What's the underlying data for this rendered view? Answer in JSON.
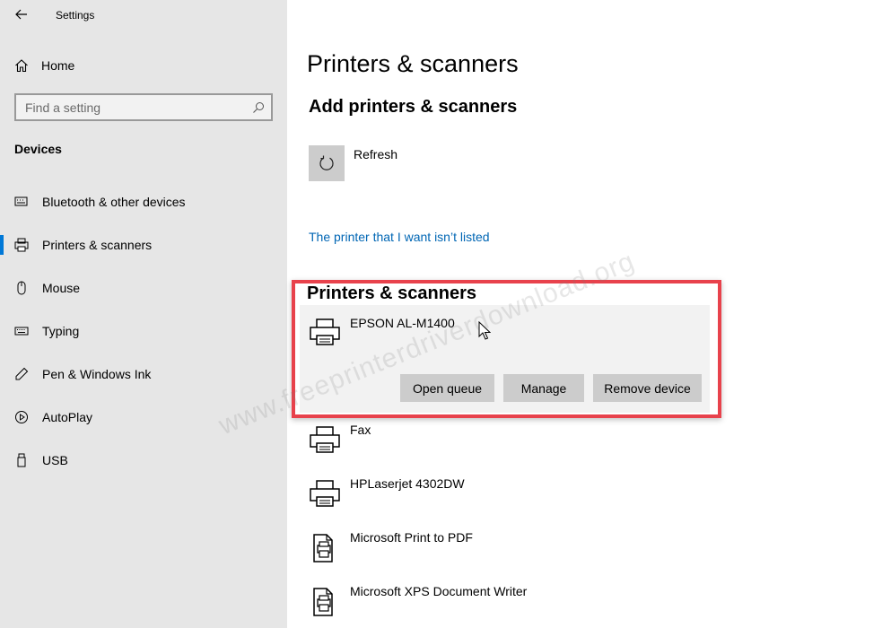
{
  "app": {
    "title": "Settings"
  },
  "sidebar": {
    "home_label": "Home",
    "search_placeholder": "Find a setting",
    "section_label": "Devices",
    "items": [
      {
        "label": "Bluetooth & other devices",
        "icon": "bluetooth-keyboard-icon"
      },
      {
        "label": "Printers & scanners",
        "icon": "printer-icon",
        "active": true
      },
      {
        "label": "Mouse",
        "icon": "mouse-icon"
      },
      {
        "label": "Typing",
        "icon": "keyboard-icon"
      },
      {
        "label": "Pen & Windows Ink",
        "icon": "pen-icon"
      },
      {
        "label": "AutoPlay",
        "icon": "autoplay-icon"
      },
      {
        "label": "USB",
        "icon": "usb-icon"
      }
    ]
  },
  "main": {
    "title": "Printers & scanners",
    "add_title": "Add printers & scanners",
    "refresh_label": "Refresh",
    "not_listed_link": "The printer that I want isn’t listed",
    "list_title": "Printers & scanners",
    "selected_device": {
      "name": "EPSON AL-M1400",
      "buttons": {
        "open_queue": "Open queue",
        "manage": "Manage",
        "remove": "Remove device"
      }
    },
    "devices": [
      {
        "name": "Fax",
        "icon": "printer-icon"
      },
      {
        "name": "HPLaserjet 4302DW",
        "icon": "printer-icon"
      },
      {
        "name": "Microsoft Print to PDF",
        "icon": "pdf-printer-icon"
      },
      {
        "name": "Microsoft XPS Document Writer",
        "icon": "pdf-printer-icon"
      }
    ]
  },
  "watermark": "www.freeprinterdriverdownload.org",
  "colors": {
    "accent": "#0078d7",
    "link": "#0066b4",
    "highlight": "#e8424c",
    "sidebar_bg": "#e6e6e6"
  }
}
